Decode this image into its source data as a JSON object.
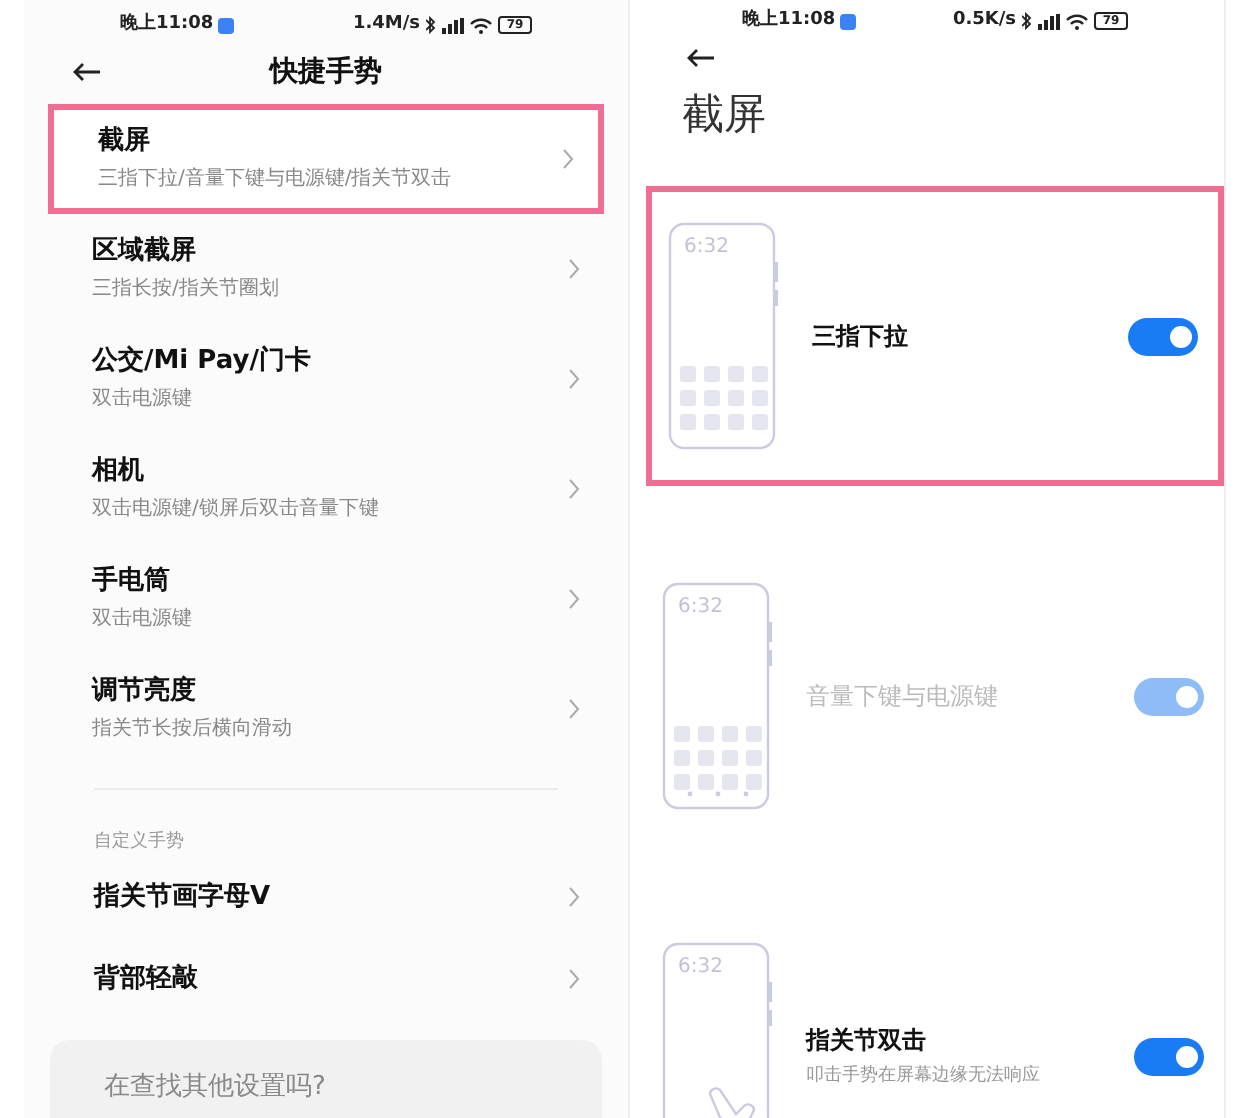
{
  "left": {
    "status_bar": {
      "time": "晚上11:08",
      "speed": "1.4M/s",
      "battery": "79"
    },
    "title": "快捷手势",
    "items": [
      {
        "title": "截屏",
        "subtitle": "三指下拉/音量下键与电源键/指关节双击",
        "highlighted": true
      },
      {
        "title": "区域截屏",
        "subtitle": "三指长按/指关节圈划",
        "highlighted": false
      },
      {
        "title": "公交/Mi Pay/门卡",
        "subtitle": "双击电源键",
        "highlighted": false
      },
      {
        "title": "相机",
        "subtitle": "双击电源键/锁屏后双击音量下键",
        "highlighted": false
      },
      {
        "title": "手电筒",
        "subtitle": "双击电源键",
        "highlighted": false
      },
      {
        "title": "调节亮度",
        "subtitle": "指关节长按后横向滑动",
        "highlighted": false
      }
    ],
    "section_label": "自定义手势",
    "custom_items": [
      {
        "title": "指关节画字母V"
      },
      {
        "title": "背部轻敲"
      }
    ],
    "search_card": {
      "text": "在查找其他设置吗?"
    }
  },
  "right": {
    "status_bar": {
      "time": "晚上11:08",
      "speed": "0.5K/s",
      "battery": "79"
    },
    "title": "截屏",
    "rows": [
      {
        "label": "三指下拉",
        "clock": "6:32",
        "kind": "plain",
        "on": true,
        "disabled": false,
        "highlighted": true
      },
      {
        "label": "音量下键与电源键",
        "clock": "6:32",
        "kind": "dock",
        "on": true,
        "disabled": true,
        "highlighted": false
      },
      {
        "label": "指关节双击",
        "subtitle": "叩击手势在屏幕边缘无法响应",
        "clock": "6:32",
        "kind": "hand",
        "on": true,
        "disabled": false,
        "highlighted": false
      }
    ]
  }
}
